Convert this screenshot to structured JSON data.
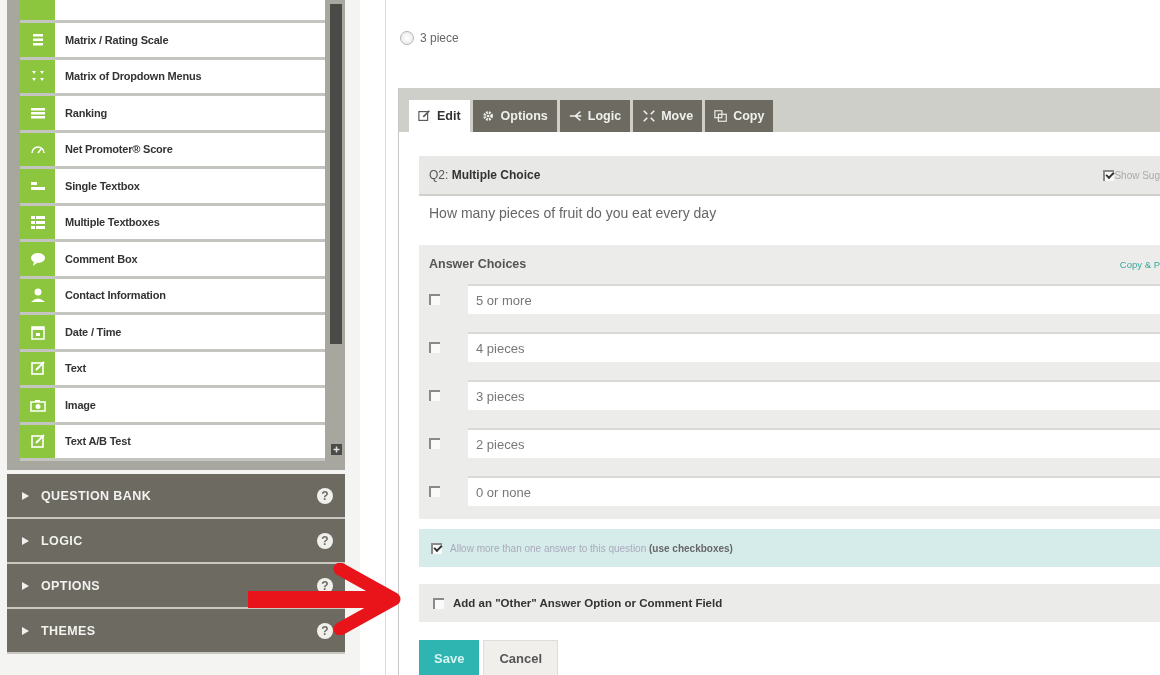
{
  "sidebar": {
    "items": [
      {
        "label": "Matrix / Rating Scale",
        "kind": "matrix"
      },
      {
        "label": "Matrix of Dropdown Menus",
        "kind": "dropdown-matrix"
      },
      {
        "label": "Ranking",
        "kind": "ranking"
      },
      {
        "label": "Net Promoter® Score",
        "kind": "nps"
      },
      {
        "label": "Single Textbox",
        "kind": "single-text"
      },
      {
        "label": "Multiple Textboxes",
        "kind": "multi-text"
      },
      {
        "label": "Comment Box",
        "kind": "comment"
      },
      {
        "label": "Contact Information",
        "kind": "contact"
      },
      {
        "label": "Date / Time",
        "kind": "datetime"
      },
      {
        "label": "Text",
        "kind": "text"
      },
      {
        "label": "Image",
        "kind": "image"
      },
      {
        "label": "Text A/B Test",
        "kind": "text"
      }
    ],
    "sections": [
      {
        "label": "QUESTION BANK",
        "help": "?"
      },
      {
        "label": "LOGIC",
        "help": "?"
      },
      {
        "label": "OPTIONS",
        "help": "?"
      },
      {
        "label": "THEMES",
        "help": "?"
      }
    ]
  },
  "preview": {
    "option": {
      "label": "3 piece",
      "selected": false
    }
  },
  "editor": {
    "tabs": [
      {
        "label": "Edit",
        "kind": "edit",
        "selected": true
      },
      {
        "label": "Options",
        "kind": "options",
        "selected": false
      },
      {
        "label": "Logic",
        "kind": "logic",
        "selected": false
      },
      {
        "label": "Move",
        "kind": "move",
        "selected": false
      },
      {
        "label": "Copy",
        "kind": "copy",
        "selected": false
      }
    ],
    "question": {
      "title": "Q2: **Multiple Choice**",
      "show_label": "Show Sug",
      "show_checked": true,
      "text": "How many pieces of fruit do you eat every day"
    },
    "answers": {
      "heading": "Answer Choices",
      "link": "Copy & P",
      "choices": [
        {
          "value": "5 or more",
          "checked": false
        },
        {
          "value": "4 pieces",
          "checked": false
        },
        {
          "value": "3 pieces",
          "checked": false
        },
        {
          "value": "2 pieces",
          "checked": false
        },
        {
          "value": "0 or none",
          "checked": false
        }
      ]
    },
    "allow_multiple": {
      "text": "Allow more than one answer to this question **(use checkboxes)**",
      "checked": true
    },
    "other_option": {
      "text": "Add an \"Other\" Answer Option or Comment Field",
      "checked": false
    },
    "buttons": [
      {
        "label": "Save",
        "kind": "primary"
      },
      {
        "label": "Cancel",
        "kind": "secondary"
      }
    ]
  }
}
